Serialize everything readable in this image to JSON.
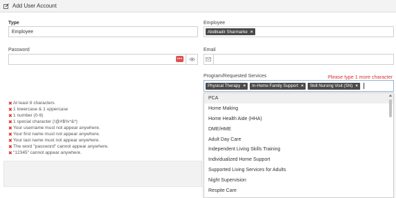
{
  "header": {
    "title": "Add User Account",
    "icon": "edit-icon"
  },
  "type": {
    "label": "Type",
    "value": "Employee"
  },
  "employee": {
    "label": "Employee",
    "chip": "Abdikadir Sharmarke"
  },
  "password": {
    "label": "Password",
    "value": "",
    "dots": "•••"
  },
  "email": {
    "label": "Email",
    "value": ""
  },
  "services": {
    "label": "Program/Requested Services",
    "warning": "Please type 1 more character",
    "selected": [
      "Physical Therapy",
      "In-Home Family Support",
      "Skill Nursing Visit (SN)"
    ],
    "remove_symbol": "×"
  },
  "password_rules": [
    "At least 8 characters",
    "1 lowercase & 1 uppercase",
    "1 number (0-9)",
    "1 special character (!@#$%^&*)",
    "Your username must not appear anywhere.",
    "Your first name must not appear anywhere.",
    "Your last name must not appear anywhere.",
    "The word \"password\" cannot appear anywhere.",
    "\"12345\" cannot appear anywhere."
  ],
  "rule_mark": "✖",
  "dropdown": {
    "options": [
      "PCA",
      "Home Making",
      "Home Health Aide (HHA)",
      "DME/HME",
      "Adult Day Care",
      "Independent Living Skills Training",
      "Individualized Home Support",
      "Supported Living Services for Adults",
      "Night Supervision",
      "Respite Care"
    ]
  },
  "colors": {
    "error": "#d9302a",
    "chip": "#4a4a4a",
    "focus_border": "#8fb3d9"
  }
}
